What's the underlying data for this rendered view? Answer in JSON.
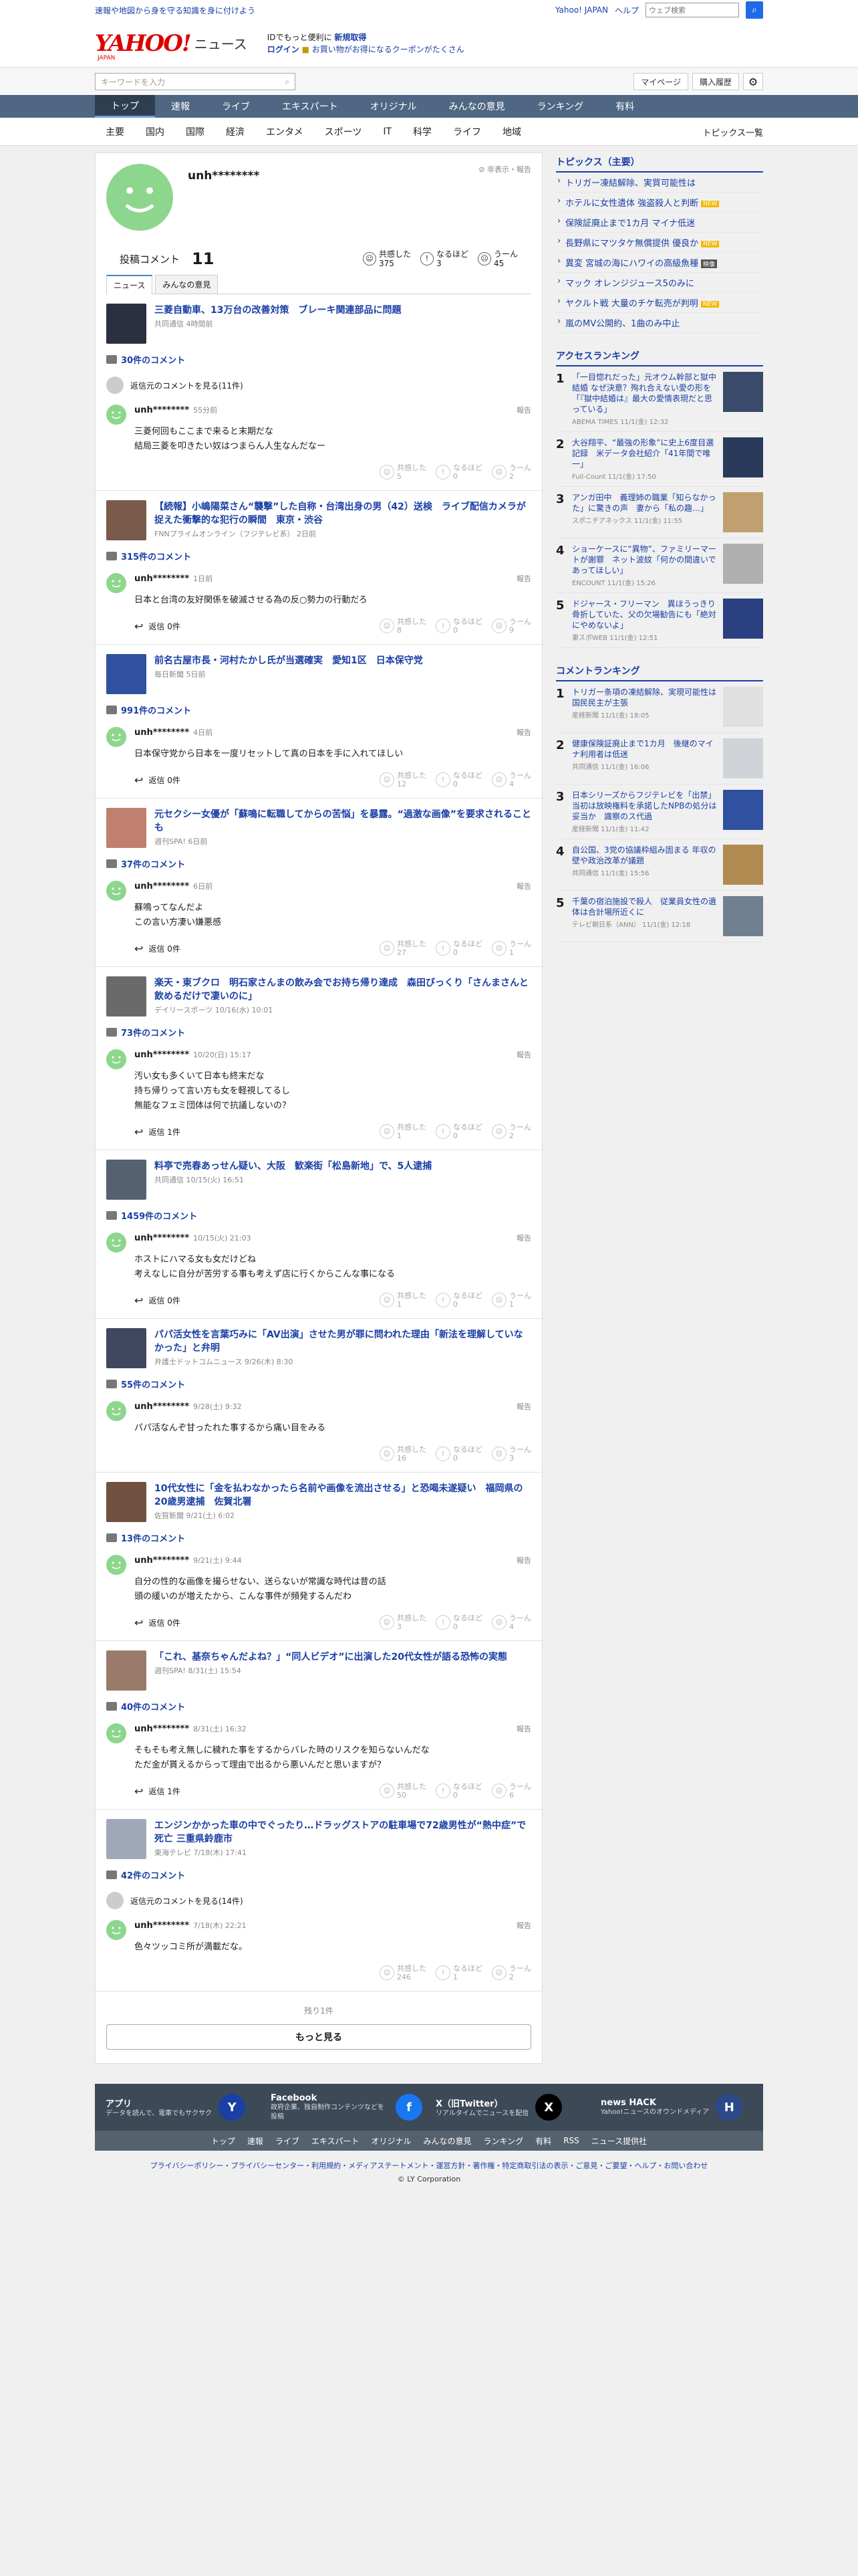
{
  "top": {
    "tagline": "速報や地図から身を守る知識を身に付けよう",
    "links": [
      "Yahoo! JAPAN",
      "ヘルプ"
    ],
    "web_placeholder": "ウェブ検索"
  },
  "header": {
    "logo": "YAHOO!",
    "logo_sub": "JAPAN",
    "logo_news": "ニュース",
    "promo_line1a": "IDでもっと便利に",
    "promo_line1b": "新規取得",
    "promo_line2a": "ログイン",
    "promo_line2b": "お買い物がお得になるクーポンがたくさん"
  },
  "search": {
    "placeholder": "キーワードを入力",
    "mypage": "マイページ",
    "history": "購入履歴"
  },
  "nav": [
    "トップ",
    "速報",
    "ライブ",
    "エキスパート",
    "オリジナル",
    "みんなの意見",
    "ランキング",
    "有料"
  ],
  "subnav": [
    "主要",
    "国内",
    "国際",
    "経済",
    "エンタメ",
    "スポーツ",
    "IT",
    "科学",
    "ライフ",
    "地域"
  ],
  "subnav_topics": "トピックス一覧",
  "profile": {
    "name": "unh********",
    "hide": "非表示・報告",
    "comment_label": "投稿コメント",
    "comment_count": "11",
    "rx": [
      {
        "label": "共感した",
        "count": "375"
      },
      {
        "label": "なるほど",
        "count": "3"
      },
      {
        "label": "うーん",
        "count": "45"
      }
    ],
    "tabs": [
      "ニュース",
      "みんなの意見"
    ]
  },
  "vote_labels": [
    "共感した",
    "なるほど",
    "うーん"
  ],
  "reply_label": "返信",
  "report": "報告",
  "see_more_author": "返信元のコメントを見る",
  "colors": {
    "link": "#1a3fa5",
    "avatar": "#8dd68d"
  },
  "items": [
    {
      "title": "三菱自動車、13万台の改善対策　ブレーキ関連部品に問題",
      "src": "共同通信 4時間前",
      "comments": "30件のコメント",
      "seemore": "返信元のコメントを見る(11件)",
      "user": "unh********",
      "time": "55分前",
      "text": "三菱何回もここまで来ると末期だな\n結局三菱を叩きたい奴はつまらん人生なんだなー",
      "reply": "",
      "v": [
        "5",
        "0",
        "2"
      ]
    },
    {
      "title": "【続報】小嶋陽菜さん“襲撃”した自称・台湾出身の男（42）送検　ライブ配信カメラが捉えた衝撃的な犯行の瞬間　東京・渋谷",
      "src": "FNNプライムオンライン（フジテレビ系） 2日前",
      "comments": "315件のコメント",
      "seemore": "",
      "user": "unh********",
      "time": "1日前",
      "text": "日本と台湾の友好関係を破滅させる為の反○勢力の行動だろ",
      "reply": "返信 0件",
      "v": [
        "8",
        "0",
        "9"
      ]
    },
    {
      "title": "前名古屋市長・河村たかし氏が当選確実　愛知1区　日本保守党",
      "src": "毎日新聞 5日前",
      "comments": "991件のコメント",
      "seemore": "",
      "user": "unh********",
      "time": "4日前",
      "text": "日本保守党から日本を一度リセットして真の日本を手に入れてほしい",
      "reply": "返信 0件",
      "v": [
        "12",
        "0",
        "4"
      ]
    },
    {
      "title": "元セクシー女優が「蘇鳴に転職してからの苦悩」を暴露。“過激な画像”を要求されることも",
      "src": "週刊SPA! 6日前",
      "comments": "37件のコメント",
      "seemore": "",
      "user": "unh********",
      "time": "6日前",
      "text": "蘇鳴ってなんだよ\nこの言い方凄い嫌悪感",
      "reply": "返信 0件",
      "v": [
        "27",
        "0",
        "1"
      ]
    },
    {
      "title": "楽天・東ブクロ　明石家さんまの飲み会でお持ち帰り達成　森田びっくり「さんまさんと飲めるだけで凄いのに」",
      "src": "デイリースポーツ 10/16(水) 10:01",
      "comments": "73件のコメント",
      "seemore": "",
      "user": "unh********",
      "time": "10/20(日) 15:17",
      "text": "汚い女も多くいて日本も終末だな\n持ち帰りって言い方も女を軽視してるし\n無能なフェミ団体は何で抗議しないの？",
      "reply": "返信 1件",
      "v": [
        "1",
        "0",
        "2"
      ]
    },
    {
      "title": "料亭で売春あっせん疑い、大阪　歓楽街「松島新地」で、5人逮捕",
      "src": "共同通信 10/15(火) 16:51",
      "comments": "1459件のコメント",
      "seemore": "",
      "user": "unh********",
      "time": "10/15(火) 21:03",
      "text": "ホストにハマる女も女だけどね\n考えなしに自分が苦労する事も考えず店に行くからこんな事になる",
      "reply": "返信 0件",
      "v": [
        "1",
        "0",
        "1"
      ]
    },
    {
      "title": "パパ活女性を言葉巧みに「AV出演」させた男が罪に問われた理由「新法を理解していなかった」と弁明",
      "src": "弁護士ドットコムニュース 9/26(木) 8:30",
      "comments": "55件のコメント",
      "seemore": "",
      "user": "unh********",
      "time": "9/28(土) 9:32",
      "text": "パパ活なんぞ甘ったれた事するから痛い目をみる",
      "reply": "",
      "v": [
        "16",
        "0",
        "3"
      ]
    },
    {
      "title": "10代女性に「金を払わなかったら名前や画像を流出させる」と恐喝未遂疑い　福岡県の20歳男逮捕　佐賀北署",
      "src": "佐賀新聞 9/21(土) 6:02",
      "comments": "13件のコメント",
      "seemore": "",
      "user": "unh********",
      "time": "9/21(土) 9:44",
      "text": "自分の性的な画像を撮らせない、送らないが常識な時代は昔の話\n頭の緩いのが増えたから、こんな事件が頻発するんだわ",
      "reply": "返信 0件",
      "v": [
        "3",
        "0",
        "4"
      ]
    },
    {
      "title": "「これ、基奈ちゃんだよね？」“同人ビデオ”に出演した20代女性が語る恐怖の実態",
      "src": "週刊SPA! 8/31(土) 15:54",
      "comments": "40件のコメント",
      "seemore": "",
      "user": "unh********",
      "time": "8/31(土) 16:32",
      "text": "そもそも考え無しに穢れた事をするからバレた時のリスクを知らないんだな\nただ金が貰えるからって理由で出るから悪いんだと思いますが？",
      "reply": "返信 1件",
      "v": [
        "50",
        "0",
        "6"
      ]
    },
    {
      "title": "エンジンかかった車の中でぐったり…ドラッグストアの駐車場で72歳男性が“熱中症”で死亡 三重県鈴鹿市",
      "src": "東海テレビ 7/18(木) 17:41",
      "comments": "42件のコメント",
      "seemore": "返信元のコメントを見る(14件)",
      "user": "unh********",
      "time": "7/18(木) 22:21",
      "text": "色々ツッコミ所が満載だな。",
      "reply": "",
      "v": [
        "246",
        "1",
        "2"
      ]
    }
  ],
  "more": {
    "remain": "残り1件",
    "button": "もっと見る"
  },
  "topics": {
    "head": "トピックス（主要）",
    "items": [
      {
        "t": "トリガー凍結解除、実質可能性は",
        "b": ""
      },
      {
        "t": "ホテルに女性遺体 強盗殺人と判断",
        "b": "NEW"
      },
      {
        "t": "保険証廃止まで1カ月 マイナ低迷",
        "b": ""
      },
      {
        "t": "長野県にマツタケ無償提供 優良か",
        "b": "NEW"
      },
      {
        "t": "異変 宮城の海にハワイの高級魚種",
        "b": "映像"
      },
      {
        "t": "マック オレンジジュース5のみに",
        "b": ""
      },
      {
        "t": "ヤクルト戦 大量のチケ転売が判明",
        "b": "NEW"
      },
      {
        "t": "嵐のMV公開約、1曲のみ中止",
        "b": ""
      }
    ]
  },
  "access": {
    "head": "アクセスランキング",
    "items": [
      {
        "t": "「一目惚れだった」元オウム幹部と獄中結婚 なぜ決意？殉れ合えない愛の形を「『獄中結婚は』最大の愛情表現だと思っている」",
        "s": "ABEMA TIMES 11/1(金) 12:32"
      },
      {
        "t": "大谷翔平、“最強の形象”に史上6度目選記録　米データ会社紹介「41年間で唯一」",
        "s": "Full-Count 11/1(金) 17:50"
      },
      {
        "t": "アンガ田中　義理姉の職業「知らなかった」に驚きの声　妻から「私の趣…」",
        "s": "スポニチアネックス 11/1(金) 11:55"
      },
      {
        "t": "ショーケースに“異物”、ファミリーマートが謝罪　ネット波紋「何かの間違いであってほしい」",
        "s": "ENCOUNT 11/1(金) 15:26"
      },
      {
        "t": "ドジャース・フリーマン　異ほうっきり骨折していた、父の欠場勧告にも「絶対にやめないよ」",
        "s": "東スポWEB 11/1(金) 12:51"
      }
    ]
  },
  "commentrank": {
    "head": "コメントランキング",
    "items": [
      {
        "t": "トリガー条項の凍結解除、実現可能性は　国民民主が主張",
        "s": "産経新聞 11/1(金) 18:05"
      },
      {
        "t": "健康保険証廃止まで1カ月　後継のマイナ利用者は低迷",
        "s": "共同通信 11/1(金) 16:06"
      },
      {
        "t": "日本シリーズからフジテレビを「出禁」　当初は放映権料を承諾したNPBの処分は妥当か　識察のス代過",
        "s": "産経新聞 11/1(金) 11:42"
      },
      {
        "t": "自公国、3党の協議枠組み固まる 年収の壁や政治改革が議題",
        "s": "共同通信 11/1(金) 15:56"
      },
      {
        "t": "千葉の宿泊施設で殺人　従業員女性の遺体は合計場所近くに",
        "s": "テレビ朝日系（ANN） 11/1(金) 12:18"
      }
    ]
  },
  "footer": {
    "apps": [
      {
        "t": "アプリ",
        "d": "データを読んで、電車でもサクサク",
        "i": "Y"
      },
      {
        "t": "Facebook",
        "d": "政府企業、独自制作コンテンツなどを投稿",
        "i": "f"
      },
      {
        "t": "X（旧Twitter）",
        "d": "リアルタイムでニュースを配信",
        "i": "X"
      },
      {
        "t": "news HACK",
        "d": "Yahoo!ニュースのオウンドメディア",
        "i": "H"
      }
    ],
    "nav": [
      "トップ",
      "速報",
      "ライブ",
      "エキスパート",
      "オリジナル",
      "みんなの意見",
      "ランキング",
      "有料",
      "RSS",
      "ニュース提供社"
    ],
    "links": "プライバシーポリシー・プライバシーセンター・利用規約・メディアステートメント・運営方針・著作権・特定商取引法の表示・ご意見・ご要望・ヘルプ・お問い合わせ",
    "copy": "© LY Corporation"
  }
}
